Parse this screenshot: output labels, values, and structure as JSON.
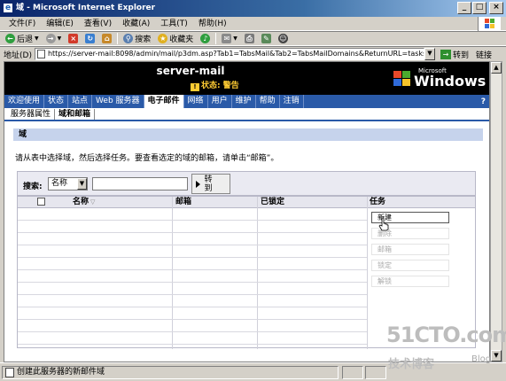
{
  "window": {
    "title": "域 - Microsoft Internet Explorer",
    "controls": [
      "_",
      "□",
      "×"
    ]
  },
  "menu": [
    "文件(F)",
    "编辑(E)",
    "查看(V)",
    "收藏(A)",
    "工具(T)",
    "帮助(H)"
  ],
  "toolbar": {
    "back": "后退",
    "search": "搜索",
    "favorites": "收藏夹"
  },
  "address": {
    "label": "地址(D)",
    "url": "https://server-mail:8098/admin/mail/p3dm.asp?Tab1=TabsMail&Tab2=TabsMailDomains&ReturnURL=tasks%2F",
    "go": "转到",
    "links": "链接"
  },
  "banner": {
    "server": "server-mail",
    "status": "状态: 警告",
    "logo_small": "Microsoft",
    "logo": "Windows"
  },
  "nav": {
    "tabs": [
      "欢迎使用",
      "状态",
      "站点",
      "Web 服务器",
      "电子邮件",
      "网络",
      "用户",
      "维护",
      "帮助",
      "注销"
    ],
    "active": "电子邮件",
    "help": "?"
  },
  "subnav": [
    "服务器属性",
    "域和邮箱"
  ],
  "section": {
    "title": "域",
    "instructions": "请从表中选择域，然后选择任务。要查看选定的域的邮箱，请单击“邮箱”。"
  },
  "search": {
    "label": "搜索:",
    "field": "名称",
    "value": "",
    "go": "转到"
  },
  "table": {
    "columns": [
      "名称",
      "邮箱",
      "已锁定",
      "任务"
    ],
    "row_count": 11
  },
  "tasks": [
    "新建",
    "删除",
    "邮箱",
    "锁定",
    "解锁"
  ],
  "statusbar": {
    "text": "创建此服务器的新邮件域"
  },
  "watermark": {
    "main": "51CTO.com",
    "sub": "技术博客",
    "blog": "Blog"
  },
  "colors": {
    "nav_blue": "#2a5aa8",
    "section_blue": "#c6d3ec",
    "warning": "#ffcc33"
  }
}
